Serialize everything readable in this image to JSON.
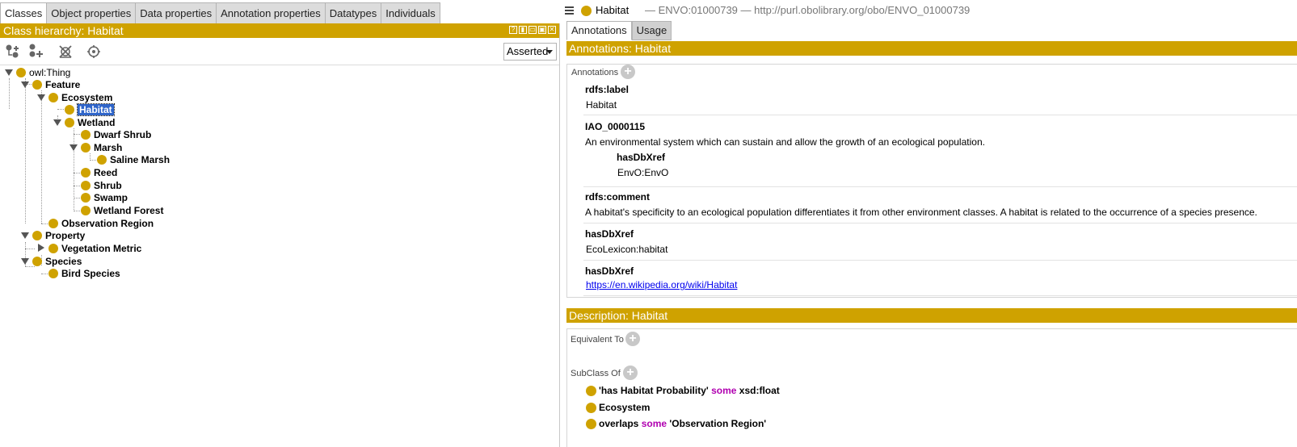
{
  "left_tabs": [
    "Classes",
    "Object properties",
    "Data properties",
    "Annotation properties",
    "Datatypes",
    "Individuals"
  ],
  "hierarchy": {
    "title": "Class hierarchy: Habitat",
    "header_buttons": [
      "?",
      "▮",
      "▭",
      "▣",
      "✕"
    ],
    "mode": "Asserted",
    "toolbar": [
      "add-subclass-icon",
      "add-sibling-icon",
      "delete-class-icon",
      "find-icon"
    ],
    "nodes": [
      {
        "label": "owl:Thing",
        "plain": true
      },
      {
        "label": "Feature"
      },
      {
        "label": "Ecosystem"
      },
      {
        "label": "Habitat",
        "selected": true
      },
      {
        "label": "Wetland"
      },
      {
        "label": "Dwarf Shrub"
      },
      {
        "label": "Marsh"
      },
      {
        "label": "Saline Marsh"
      },
      {
        "label": "Reed"
      },
      {
        "label": "Shrub"
      },
      {
        "label": "Swamp"
      },
      {
        "label": "Wetland Forest"
      },
      {
        "label": "Observation Region"
      },
      {
        "label": "Property"
      },
      {
        "label": "Vegetation Metric"
      },
      {
        "label": "Species"
      },
      {
        "label": "Bird Species"
      }
    ]
  },
  "entity": {
    "title": "Habitat",
    "meta": "— ENVO:01000739 — http://purl.obolibrary.org/obo/ENVO_01000739"
  },
  "right_tabs": [
    "Annotations",
    "Usage"
  ],
  "annotations": {
    "header": "Annotations: Habitat",
    "section_label": "Annotations",
    "items": [
      {
        "prop": "rdfs:label",
        "value": "Habitat"
      },
      {
        "prop": "IAO_0000115",
        "value": "An environmental system which can sustain and allow the growth of an ecological population.",
        "sub_prop": "hasDbXref",
        "sub_value": "EnvO:EnvO"
      },
      {
        "prop": "rdfs:comment",
        "value": "A habitat's specificity to an ecological population differentiates it from other environment classes. A habitat is related to the occurrence of a species presence."
      },
      {
        "prop": "hasDbXref",
        "value": "EcoLexicon:habitat"
      },
      {
        "prop": "hasDbXref",
        "value": "https://en.wikipedia.org/wiki/Habitat"
      }
    ]
  },
  "description": {
    "header": "Description: Habitat",
    "equivalent_label": "Equivalent To",
    "subclass_label": "SubClass Of",
    "subclasses": [
      {
        "a": "'has Habitat Probability'",
        "kw": "some",
        "b": "xsd:float"
      },
      {
        "a": "Ecosystem",
        "kw": "",
        "b": ""
      },
      {
        "a": "overlaps",
        "kw": "some",
        "b": "'Observation Region'"
      }
    ]
  },
  "colors": {
    "accent": "#cfa200",
    "selection": "#2f65ca",
    "keyword": "#b000b0",
    "link": "#0000ee"
  }
}
